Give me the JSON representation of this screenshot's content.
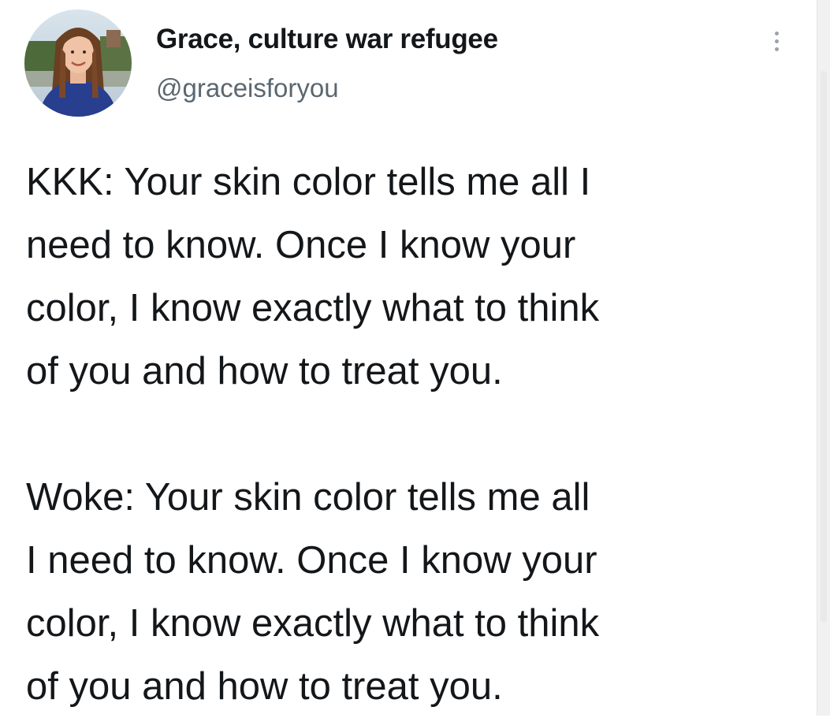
{
  "tweet": {
    "author": {
      "display_name": "Grace, culture war refugee",
      "handle": "@graceisforyou",
      "avatar": "profile-photo"
    },
    "more_icon": "vertical-ellipsis-icon",
    "paragraphs": [
      "KKK: Your skin color tells me all I\nneed to know. Once I know your\ncolor, I know exactly what to think\nof you and how to treat you.",
      "Woke: Your skin color tells me all\nI need to know. Once I know your\ncolor, I know exactly what to think\nof you and how to treat you."
    ]
  },
  "colors": {
    "text_primary": "#14171a",
    "text_secondary": "#5b6770",
    "background": "#ffffff"
  }
}
